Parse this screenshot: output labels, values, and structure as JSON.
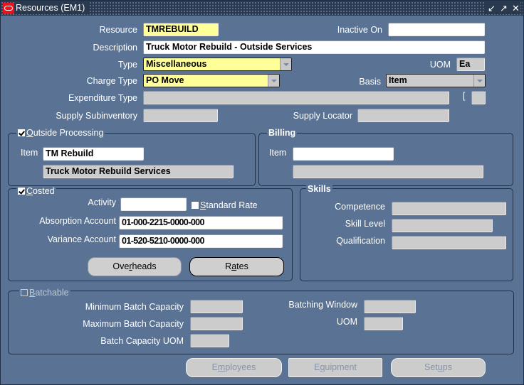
{
  "window": {
    "title": "Resources (EM1)",
    "controls": [
      "minimize-icon",
      "maximize-icon",
      "close-icon"
    ],
    "control_glyphs": [
      "↙",
      "⬏",
      "✕"
    ]
  },
  "header": {
    "resource_label": "Resource",
    "resource_value": "TMREBUILD",
    "inactive_on_label": "Inactive On",
    "inactive_on_value": "",
    "description_label": "Description",
    "description_value": "Truck Motor Rebuild - Outside Services",
    "type_label": "Type",
    "type_value": "Miscellaneous",
    "uom_label": "UOM",
    "uom_value": "Ea",
    "charge_type_label": "Charge Type",
    "charge_type_value": "PO Move",
    "basis_label": "Basis",
    "basis_value": "Item",
    "expenditure_type_label": "Expenditure Type",
    "expenditure_type_value": "",
    "bracket_text": "[",
    "supply_subinventory_label": "Supply Subinventory",
    "supply_subinventory_value": "",
    "supply_locator_label": "Supply Locator",
    "supply_locator_value": ""
  },
  "outside_processing": {
    "checkbox_label_prefix": "",
    "checkbox_mnemonic": "O",
    "checkbox_label_rest": "utside Processing",
    "checked": true,
    "item_label": "Item",
    "item_value": "TM Rebuild",
    "item_description": "Truck Motor Rebuild Services"
  },
  "billing": {
    "title": "Billing",
    "item_label": "Item",
    "item_value": "",
    "item_description": ""
  },
  "costed": {
    "checkbox_mnemonic": "C",
    "checkbox_label_rest": "osted",
    "checked": true,
    "activity_label": "Activity",
    "activity_value": "",
    "standard_rate_mnemonic": "S",
    "standard_rate_rest": "tandard Rate",
    "standard_rate_checked": false,
    "absorption_label": "Absorption Account",
    "absorption_value": "01-000-2215-0000-000",
    "variance_label": "Variance Account",
    "variance_value": "01-520-5210-0000-000",
    "overheads_pre": "Ove",
    "overheads_mnemonic": "r",
    "overheads_post": "heads",
    "rates_pre": "R",
    "rates_mnemonic": "a",
    "rates_post": "tes"
  },
  "skills": {
    "title": "Skills",
    "competence_label": "Competence",
    "competence_value": "",
    "skill_level_label": "Skill Level",
    "skill_level_value": "",
    "qualification_label": "Qualification",
    "qualification_value": ""
  },
  "batch": {
    "checkbox_mnemonic": "B",
    "checkbox_label_rest": "atchable",
    "checked": false,
    "min_label": "Minimum Batch Capacity",
    "min_value": "",
    "max_label": "Maximum Batch Capacity",
    "max_value": "",
    "uom_label": "Batch Capacity UOM",
    "uom_value": "",
    "window_label": "Batching Window",
    "window_value": "",
    "window_uom_label": "UOM",
    "window_uom_value": ""
  },
  "footer_buttons": {
    "employees_pre": "E",
    "employees_mnemonic": "m",
    "employees_post": "ployees",
    "equipment_pre": "E",
    "equipment_mnemonic": "q",
    "equipment_post": "uipment",
    "setups_pre": "Set",
    "setups_mnemonic": "u",
    "setups_post": "ps"
  }
}
